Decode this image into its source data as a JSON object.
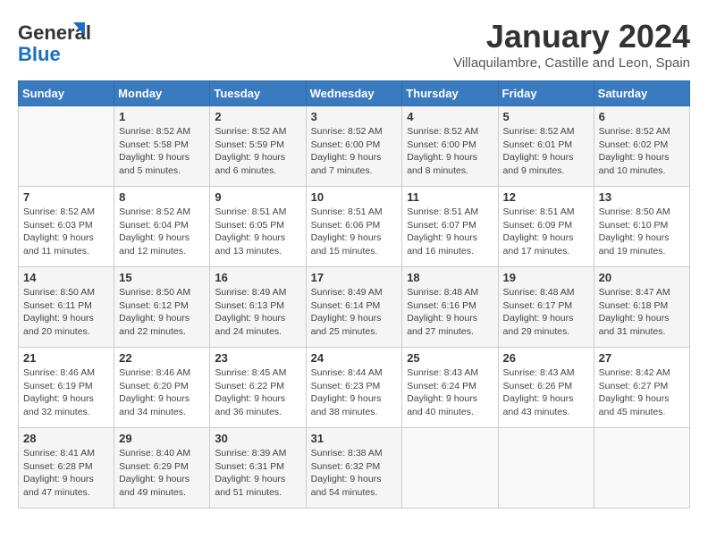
{
  "logo": {
    "line1": "General",
    "line2": "Blue"
  },
  "title": "January 2024",
  "location": "Villaquilambre, Castille and Leon, Spain",
  "days_of_week": [
    "Sunday",
    "Monday",
    "Tuesday",
    "Wednesday",
    "Thursday",
    "Friday",
    "Saturday"
  ],
  "weeks": [
    [
      {
        "day": "",
        "info": ""
      },
      {
        "day": "1",
        "info": "Sunrise: 8:52 AM\nSunset: 5:58 PM\nDaylight: 9 hours\nand 5 minutes."
      },
      {
        "day": "2",
        "info": "Sunrise: 8:52 AM\nSunset: 5:59 PM\nDaylight: 9 hours\nand 6 minutes."
      },
      {
        "day": "3",
        "info": "Sunrise: 8:52 AM\nSunset: 6:00 PM\nDaylight: 9 hours\nand 7 minutes."
      },
      {
        "day": "4",
        "info": "Sunrise: 8:52 AM\nSunset: 6:00 PM\nDaylight: 9 hours\nand 8 minutes."
      },
      {
        "day": "5",
        "info": "Sunrise: 8:52 AM\nSunset: 6:01 PM\nDaylight: 9 hours\nand 9 minutes."
      },
      {
        "day": "6",
        "info": "Sunrise: 8:52 AM\nSunset: 6:02 PM\nDaylight: 9 hours\nand 10 minutes."
      }
    ],
    [
      {
        "day": "7",
        "info": "Sunrise: 8:52 AM\nSunset: 6:03 PM\nDaylight: 9 hours\nand 11 minutes."
      },
      {
        "day": "8",
        "info": "Sunrise: 8:52 AM\nSunset: 6:04 PM\nDaylight: 9 hours\nand 12 minutes."
      },
      {
        "day": "9",
        "info": "Sunrise: 8:51 AM\nSunset: 6:05 PM\nDaylight: 9 hours\nand 13 minutes."
      },
      {
        "day": "10",
        "info": "Sunrise: 8:51 AM\nSunset: 6:06 PM\nDaylight: 9 hours\nand 15 minutes."
      },
      {
        "day": "11",
        "info": "Sunrise: 8:51 AM\nSunset: 6:07 PM\nDaylight: 9 hours\nand 16 minutes."
      },
      {
        "day": "12",
        "info": "Sunrise: 8:51 AM\nSunset: 6:09 PM\nDaylight: 9 hours\nand 17 minutes."
      },
      {
        "day": "13",
        "info": "Sunrise: 8:50 AM\nSunset: 6:10 PM\nDaylight: 9 hours\nand 19 minutes."
      }
    ],
    [
      {
        "day": "14",
        "info": "Sunrise: 8:50 AM\nSunset: 6:11 PM\nDaylight: 9 hours\nand 20 minutes."
      },
      {
        "day": "15",
        "info": "Sunrise: 8:50 AM\nSunset: 6:12 PM\nDaylight: 9 hours\nand 22 minutes."
      },
      {
        "day": "16",
        "info": "Sunrise: 8:49 AM\nSunset: 6:13 PM\nDaylight: 9 hours\nand 24 minutes."
      },
      {
        "day": "17",
        "info": "Sunrise: 8:49 AM\nSunset: 6:14 PM\nDaylight: 9 hours\nand 25 minutes."
      },
      {
        "day": "18",
        "info": "Sunrise: 8:48 AM\nSunset: 6:16 PM\nDaylight: 9 hours\nand 27 minutes."
      },
      {
        "day": "19",
        "info": "Sunrise: 8:48 AM\nSunset: 6:17 PM\nDaylight: 9 hours\nand 29 minutes."
      },
      {
        "day": "20",
        "info": "Sunrise: 8:47 AM\nSunset: 6:18 PM\nDaylight: 9 hours\nand 31 minutes."
      }
    ],
    [
      {
        "day": "21",
        "info": "Sunrise: 8:46 AM\nSunset: 6:19 PM\nDaylight: 9 hours\nand 32 minutes."
      },
      {
        "day": "22",
        "info": "Sunrise: 8:46 AM\nSunset: 6:20 PM\nDaylight: 9 hours\nand 34 minutes."
      },
      {
        "day": "23",
        "info": "Sunrise: 8:45 AM\nSunset: 6:22 PM\nDaylight: 9 hours\nand 36 minutes."
      },
      {
        "day": "24",
        "info": "Sunrise: 8:44 AM\nSunset: 6:23 PM\nDaylight: 9 hours\nand 38 minutes."
      },
      {
        "day": "25",
        "info": "Sunrise: 8:43 AM\nSunset: 6:24 PM\nDaylight: 9 hours\nand 40 minutes."
      },
      {
        "day": "26",
        "info": "Sunrise: 8:43 AM\nSunset: 6:26 PM\nDaylight: 9 hours\nand 43 minutes."
      },
      {
        "day": "27",
        "info": "Sunrise: 8:42 AM\nSunset: 6:27 PM\nDaylight: 9 hours\nand 45 minutes."
      }
    ],
    [
      {
        "day": "28",
        "info": "Sunrise: 8:41 AM\nSunset: 6:28 PM\nDaylight: 9 hours\nand 47 minutes."
      },
      {
        "day": "29",
        "info": "Sunrise: 8:40 AM\nSunset: 6:29 PM\nDaylight: 9 hours\nand 49 minutes."
      },
      {
        "day": "30",
        "info": "Sunrise: 8:39 AM\nSunset: 6:31 PM\nDaylight: 9 hours\nand 51 minutes."
      },
      {
        "day": "31",
        "info": "Sunrise: 8:38 AM\nSunset: 6:32 PM\nDaylight: 9 hours\nand 54 minutes."
      },
      {
        "day": "",
        "info": ""
      },
      {
        "day": "",
        "info": ""
      },
      {
        "day": "",
        "info": ""
      }
    ]
  ]
}
